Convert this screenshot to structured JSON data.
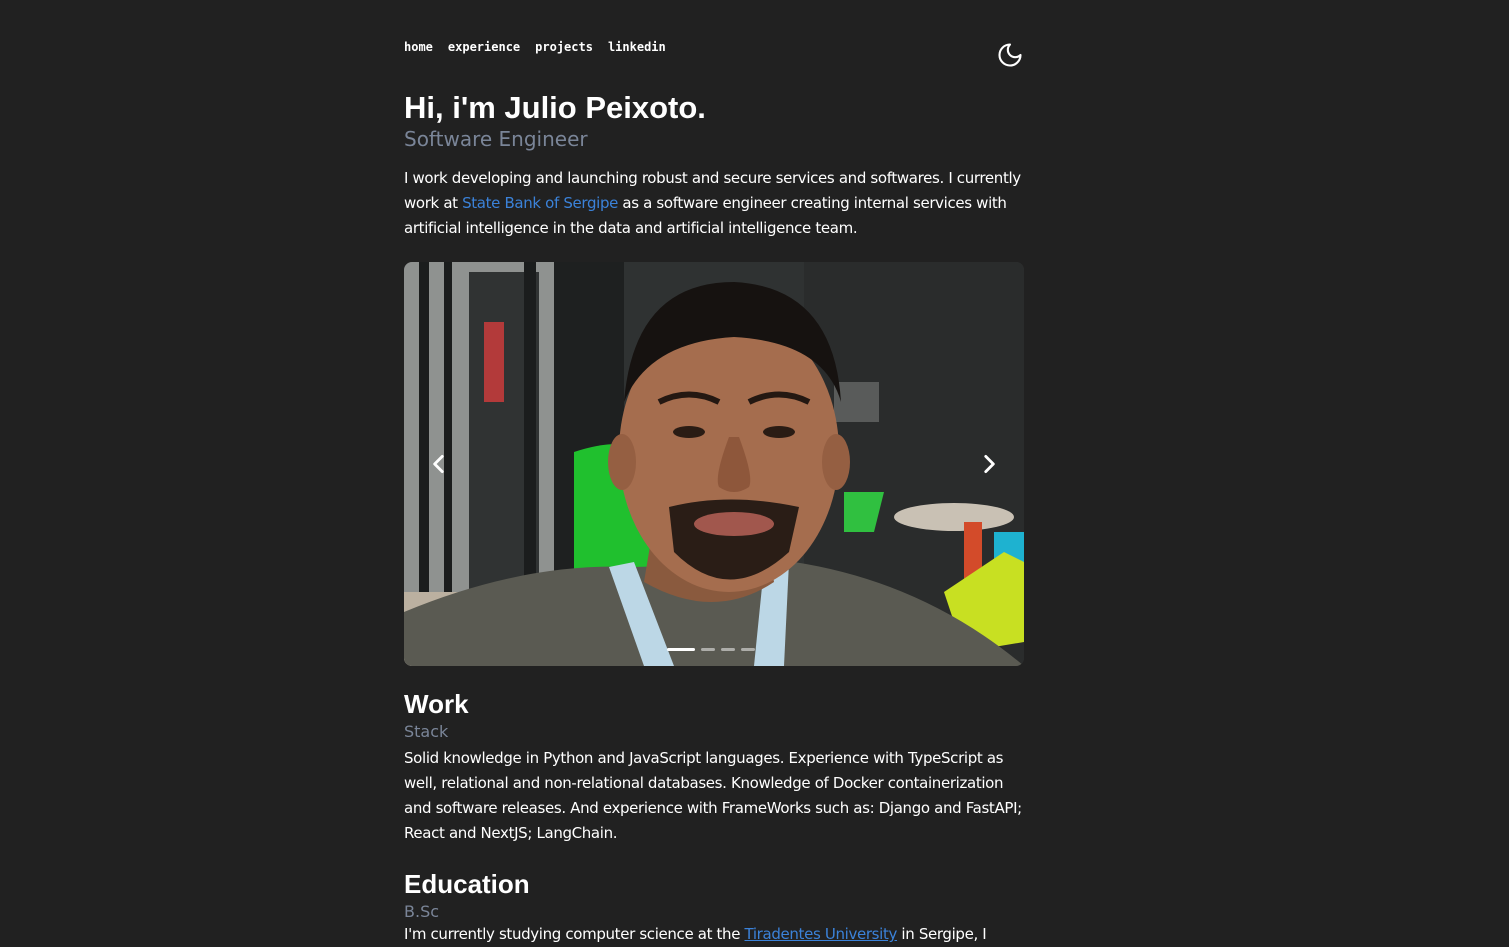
{
  "nav": {
    "items": [
      "home",
      "experience",
      "projects",
      "linkedin"
    ]
  },
  "theme_toggle": {
    "icon": "moon-icon"
  },
  "hero": {
    "title": "Hi, i'm Julio Peixoto.",
    "subtitle": "Software Engineer",
    "intro_before": "I work developing and launching robust and secure services and softwares. I currently work at ",
    "intro_link": "State Bank of Sergipe",
    "intro_after": " as a software engineer creating internal services with artificial intelligence in the data and artificial intelligence team."
  },
  "carousel": {
    "prev_icon": "chevron-left-icon",
    "next_icon": "chevron-right-icon",
    "slide_count": 4,
    "active_slide": 1
  },
  "work": {
    "title": "Work",
    "subtitle": "Stack",
    "text": "Solid knowledge in Python and JavaScript languages. Experience with TypeScript as well, relational and non-relational databases. Knowledge of Docker containerization and software releases. And experience with FrameWorks such as: Django and FastAPI; React and NextJS; LangChain."
  },
  "education": {
    "title": "Education",
    "subtitle": "B.Sc",
    "text_before": "I'm currently studying computer science at the ",
    "text_link": "Tiradentes University",
    "text_after": " in Sergipe, I"
  },
  "colors": {
    "background": "#212121",
    "accent_link": "#3b82d9",
    "muted_text": "#7a8598"
  }
}
